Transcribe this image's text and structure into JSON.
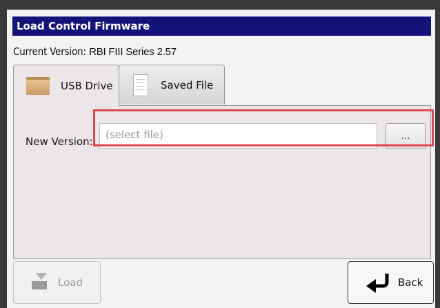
{
  "window": {
    "title": "Load Control Firmware"
  },
  "current_version": {
    "label": "Current Version:",
    "value": "RBI FIII Series 2.57"
  },
  "tabs": [
    {
      "label": "USB Drive",
      "icon": "folder-icon",
      "active": true
    },
    {
      "label": "Saved File",
      "icon": "document-icon",
      "active": false
    }
  ],
  "form": {
    "new_version_label": "New Version:",
    "new_version_placeholder": "(select file)",
    "browse_label": "..."
  },
  "buttons": {
    "load_label": "Load",
    "back_label": "Back"
  },
  "colors": {
    "title_bg": "#13137a",
    "highlight": "#e0474c"
  }
}
